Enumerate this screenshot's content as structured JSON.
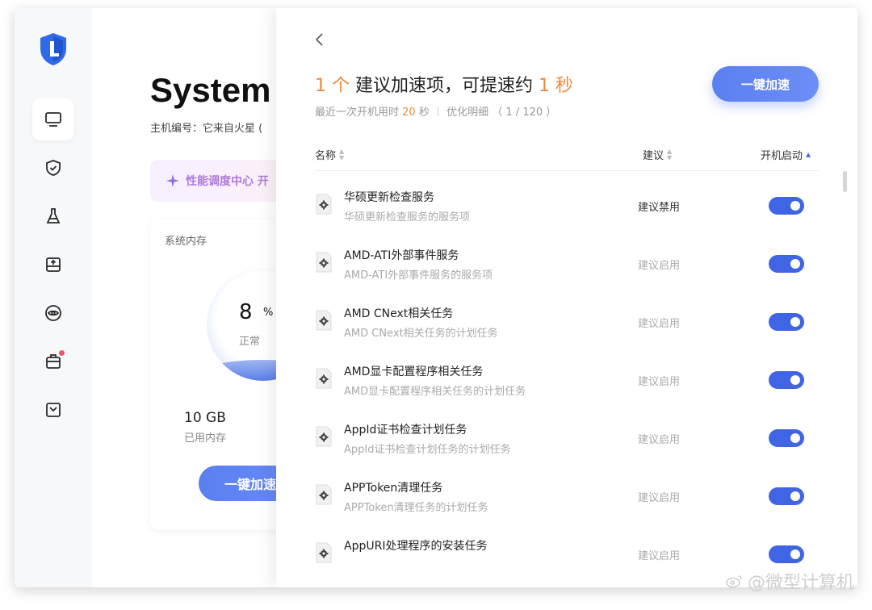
{
  "colors": {
    "accent": "#3f65e4",
    "orange": "#f08a3a",
    "button": "#5a7ff0",
    "badge": "#f0556b"
  },
  "sidebar": {
    "logo_icon": "shield-logo-icon",
    "items": [
      {
        "icon": "monitor-icon",
        "active": true
      },
      {
        "icon": "shield-check-icon"
      },
      {
        "icon": "broom-icon"
      },
      {
        "icon": "drive-icon"
      },
      {
        "icon": "eye-scan-icon"
      },
      {
        "icon": "toolbox-icon",
        "badge": true
      },
      {
        "icon": "inbox-icon"
      }
    ]
  },
  "background": {
    "title": "System",
    "host": "主机编号：它来自火星 (",
    "banner": "性能调度中心 开",
    "memory_card": {
      "title": "系统内存",
      "usage": "8",
      "unit": "%",
      "state": "正常",
      "used_value": "10 GB",
      "used_label": "已用内存",
      "button": "一键加速"
    }
  },
  "panel": {
    "headline": {
      "count": "1",
      "count_unit": "个",
      "text": "建议加速项，可提速约",
      "seconds": "1",
      "seconds_unit": "秒"
    },
    "sub": {
      "prefix": "最近一次开机用时",
      "boot_time": "20",
      "boot_unit": "秒",
      "detail": "优化明细 （ 1 / 120 ）"
    },
    "accelerate_button": "一键加速",
    "columns": {
      "name": "名称",
      "suggestion": "建议",
      "startup": "开机启动"
    },
    "rows": [
      {
        "title": "华硕更新检查服务",
        "desc": "华硕更新检查服务的服务项",
        "suggestion": "建议禁用",
        "enabled": true
      },
      {
        "title": "AMD-ATI外部事件服务",
        "desc": "AMD-ATI外部事件服务的服务项",
        "suggestion": "建议启用",
        "enabled": true
      },
      {
        "title": "AMD CNext相关任务",
        "desc": "AMD CNext相关任务的计划任务",
        "suggestion": "建议启用",
        "enabled": true
      },
      {
        "title": "AMD显卡配置程序相关任务",
        "desc": "AMD显卡配置程序相关任务的计划任务",
        "suggestion": "建议启用",
        "enabled": true
      },
      {
        "title": "AppId证书检查计划任务",
        "desc": "AppId证书检查计划任务的计划任务",
        "suggestion": "建议启用",
        "enabled": true
      },
      {
        "title": "APPToken清理任务",
        "desc": "APPToken清理任务的计划任务",
        "suggestion": "建议启用",
        "enabled": true
      },
      {
        "title": "AppURI处理程序的安装任务",
        "desc": "",
        "suggestion": "建议启用",
        "enabled": true
      }
    ]
  },
  "watermark": "@微型计算机"
}
